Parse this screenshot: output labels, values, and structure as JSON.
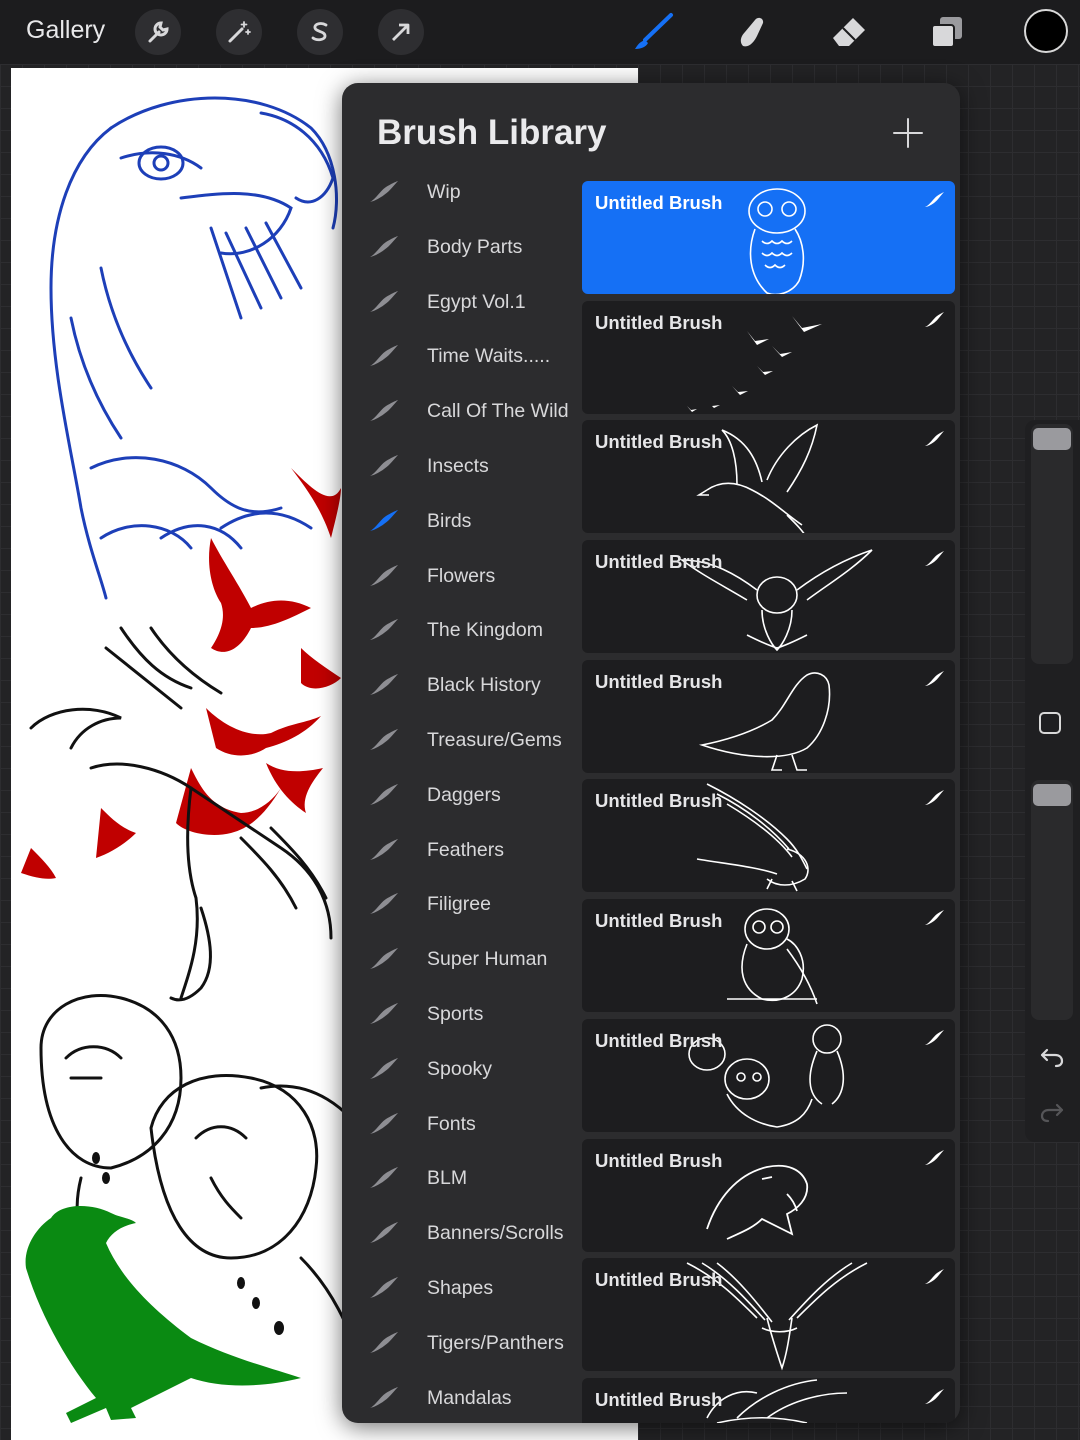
{
  "topbar": {
    "gallery_label": "Gallery",
    "left_tools": [
      "wrench-icon",
      "magic-wand-icon",
      "selection-s-icon",
      "transform-arrow-icon"
    ],
    "right_tools": [
      "brush-icon",
      "smudge-icon",
      "eraser-icon",
      "layers-icon"
    ],
    "active_tool": "brush-icon",
    "current_color": "#000000",
    "accent_color": "#1570f5"
  },
  "brush_library": {
    "title": "Brush Library",
    "active_set": "Birds",
    "sets": [
      {
        "label": "Wip"
      },
      {
        "label": "Body Parts"
      },
      {
        "label": "Egypt Vol.1"
      },
      {
        "label": "Time Waits....."
      },
      {
        "label": "Call Of The Wild"
      },
      {
        "label": "Insects"
      },
      {
        "label": "Birds"
      },
      {
        "label": "Flowers"
      },
      {
        "label": "The Kingdom"
      },
      {
        "label": "Black History"
      },
      {
        "label": "Treasure/Gems"
      },
      {
        "label": "Daggers"
      },
      {
        "label": "Feathers"
      },
      {
        "label": "Filigree"
      },
      {
        "label": "Super Human"
      },
      {
        "label": "Sports"
      },
      {
        "label": "Spooky"
      },
      {
        "label": "Fonts"
      },
      {
        "label": "BLM"
      },
      {
        "label": "Banners/Scrolls"
      },
      {
        "label": "Shapes"
      },
      {
        "label": "Tigers/Panthers"
      },
      {
        "label": "Mandalas"
      }
    ],
    "brushes": [
      {
        "name": "Untitled Brush",
        "preview": "owl"
      },
      {
        "name": "Untitled Brush",
        "preview": "flock-of-birds"
      },
      {
        "name": "Untitled Brush",
        "preview": "pigeon-flying"
      },
      {
        "name": "Untitled Brush",
        "preview": "owl-wings-spread"
      },
      {
        "name": "Untitled Brush",
        "preview": "crow-outline"
      },
      {
        "name": "Untitled Brush",
        "preview": "eagle-landing"
      },
      {
        "name": "Untitled Brush",
        "preview": "perched-owl"
      },
      {
        "name": "Untitled Brush",
        "preview": "owl-group"
      },
      {
        "name": "Untitled Brush",
        "preview": "eagle-head"
      },
      {
        "name": "Untitled Brush",
        "preview": "eagle-attacking"
      },
      {
        "name": "Untitled Brush",
        "preview": "bird-partial"
      }
    ]
  },
  "sidebar": {
    "controls": [
      "brush-size-slider",
      "modify-button",
      "opacity-slider",
      "undo-icon",
      "redo-icon"
    ]
  }
}
